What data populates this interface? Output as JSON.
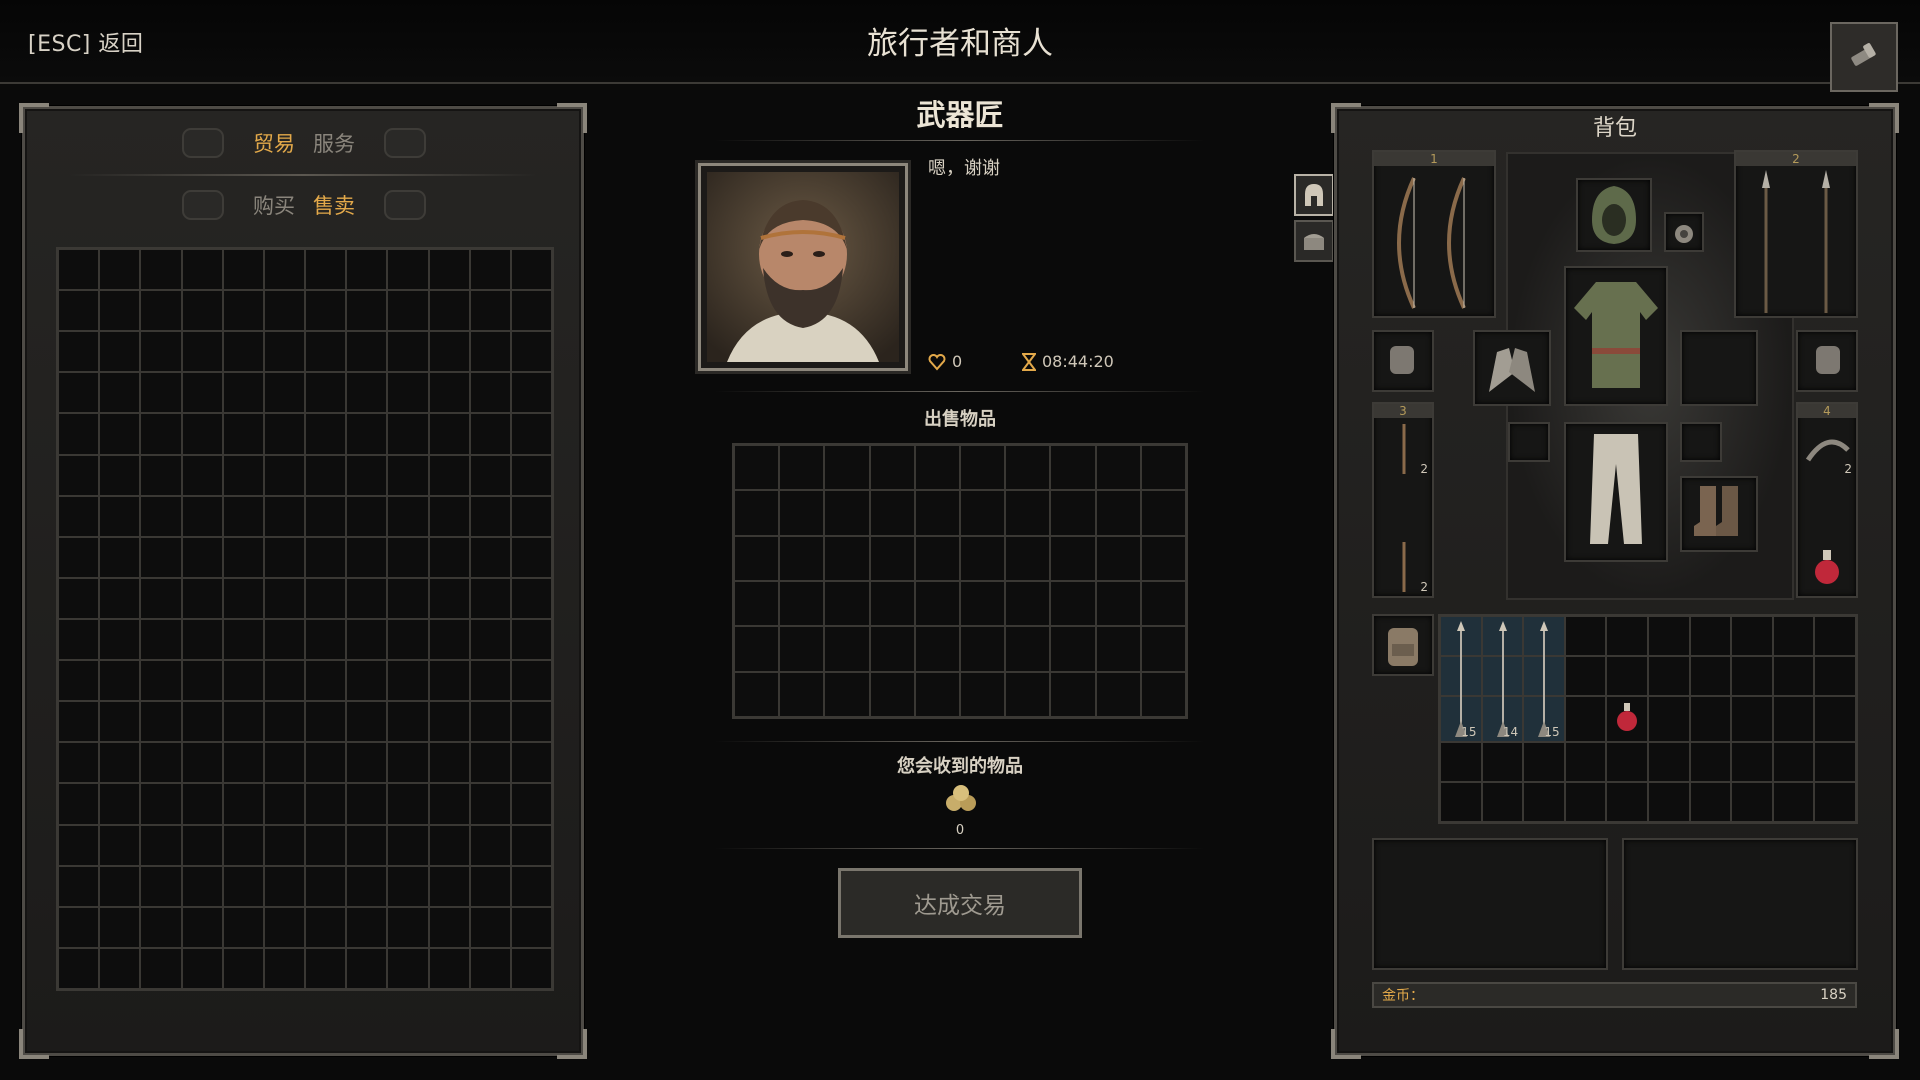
{
  "header": {
    "back_label": "[ESC] 返回",
    "title": "旅行者和商人"
  },
  "left_panel": {
    "tabs": [
      {
        "label": "贸易",
        "active": true
      },
      {
        "label": "服务",
        "active": false
      }
    ],
    "subtabs": [
      {
        "label": "购买",
        "active": false
      },
      {
        "label": "售卖",
        "active": true
      }
    ],
    "grid": {
      "cols": 12,
      "rows": 18
    }
  },
  "merchant": {
    "name": "武器匠",
    "dialog": "嗯，谢谢",
    "favor": "0",
    "time": "08:44:20"
  },
  "trade": {
    "sell_label": "出售物品",
    "sell_grid": {
      "cols": 10,
      "rows": 6
    },
    "receive_label": "您会收到的物品",
    "coin_value": "0",
    "deal_button": "达成交易"
  },
  "backpack": {
    "title": "背包",
    "weapon_slots": [
      {
        "number": "1",
        "item": "bow"
      },
      {
        "number": "2",
        "item": "spear"
      }
    ],
    "quiver_slots": [
      {
        "number": "3",
        "items": [
          {
            "name": "arrow-bundle",
            "qty": "2"
          },
          {
            "name": "empty"
          },
          {
            "name": "arrow-bundle",
            "qty": "2"
          }
        ]
      },
      {
        "number": "4",
        "items": [
          {
            "name": "rope",
            "qty": "2"
          },
          {
            "name": "empty"
          },
          {
            "name": "red-potion"
          }
        ]
      }
    ],
    "equipment": [
      "hood",
      "amulet",
      "tunic",
      "gloves",
      "trousers",
      "boots"
    ],
    "inventory_grid": {
      "cols": 10,
      "rows": 5
    },
    "inventory_items": [
      {
        "name": "arrow",
        "qty": "15"
      },
      {
        "name": "arrow",
        "qty": "14"
      },
      {
        "name": "arrow",
        "qty": "15"
      },
      {
        "name": "red-potion"
      }
    ],
    "gold_label": "金币：",
    "gold_value": "185"
  },
  "colors": {
    "accent": "#e3a94a",
    "panel": "#232220",
    "border": "#4e4b46",
    "highlight_cell": "#20303a"
  }
}
